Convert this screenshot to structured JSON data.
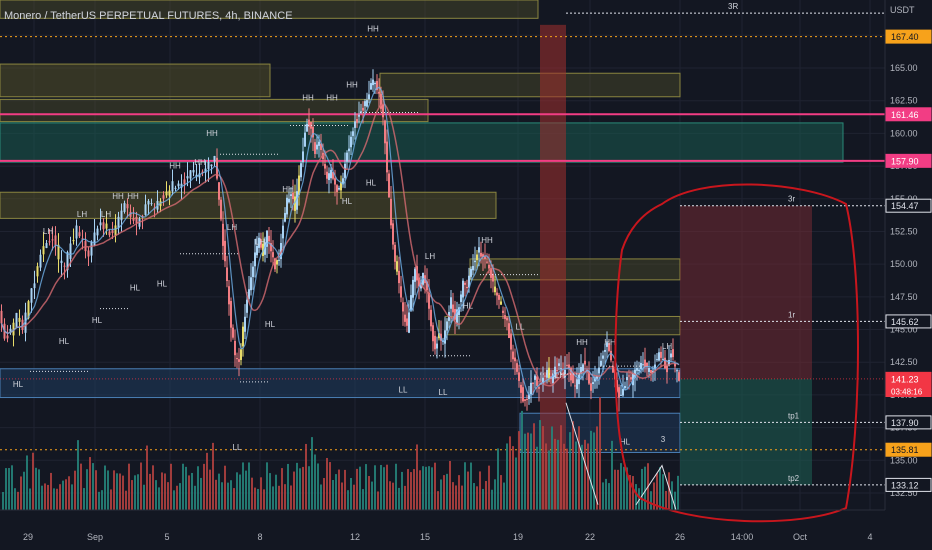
{
  "header": {
    "title": "Monero / TetherUS PERPETUAL FUTURES, 4h, BINANCE",
    "currency": "USDT"
  },
  "colors": {
    "background": "#131722",
    "up": "#a9d3f5",
    "down": "#f07c82",
    "volume_up": "#26837a",
    "volume_down": "#b0403f",
    "magenta": "#f23d84",
    "orange": "#f7a21b",
    "zone_yellow": "#5f5b2a",
    "zone_teal": "#1a5a4f",
    "zone_blue": "#1f3c5e",
    "red_circle": "#c8161d"
  },
  "chart_data": {
    "type": "candlestick",
    "symbol": "XMRUSDT.P",
    "timeframe": "4h",
    "ylim": [
      131.2,
      170.2
    ],
    "y_ticks": [
      132.5,
      135.0,
      137.5,
      140.0,
      142.5,
      145.0,
      147.5,
      150.0,
      152.5,
      155.0,
      157.5,
      160.0,
      162.5,
      165.0,
      167.5
    ],
    "x_ticks": [
      "29",
      "Sep",
      "5",
      "8",
      "12",
      "15",
      "19",
      "22",
      "26",
      "14:00",
      "Oct",
      "4"
    ],
    "price_labels": [
      {
        "text": "167.40",
        "value": 167.4,
        "style": "orange"
      },
      {
        "text": "161.46",
        "value": 161.46,
        "style": "magenta"
      },
      {
        "text": "157.90",
        "value": 157.9,
        "style": "magenta"
      },
      {
        "text": "154.47",
        "value": 154.47,
        "style": "white"
      },
      {
        "text": "145.62",
        "value": 145.62,
        "style": "white"
      },
      {
        "text": "141.23",
        "value": 141.23,
        "style": "red"
      },
      {
        "text": "03:48:16",
        "value": 140.3,
        "style": "red-small"
      },
      {
        "text": "137.90",
        "value": 137.9,
        "style": "white"
      },
      {
        "text": "135.81",
        "value": 135.81,
        "style": "orange"
      },
      {
        "text": "133.12",
        "value": 133.12,
        "style": "white"
      }
    ],
    "trade_targets": [
      {
        "label": "3R",
        "value": 169.2
      },
      {
        "label": "3r",
        "value": 154.47
      },
      {
        "label": "1r",
        "value": 145.62
      },
      {
        "label": "tp1",
        "value": 137.9
      },
      {
        "label": "tp2",
        "value": 133.12
      }
    ],
    "current_price": 141.23,
    "horizontal_lines": [
      {
        "value": 161.46,
        "style": "magenta"
      },
      {
        "value": 157.9,
        "style": "magenta"
      },
      {
        "value": 167.4,
        "style": "orange-dotted"
      },
      {
        "value": 135.81,
        "style": "orange-dotted"
      }
    ],
    "swing_labels": [
      "HH",
      "HL",
      "LH",
      "LL",
      "3"
    ],
    "price_path": [
      [
        0,
        146.2
      ],
      [
        6,
        144.3
      ],
      [
        12,
        144.8
      ],
      [
        18,
        146.0
      ],
      [
        24,
        145.0
      ],
      [
        30,
        147.1
      ],
      [
        36,
        148.8
      ],
      [
        42,
        150.6
      ],
      [
        48,
        151.9
      ],
      [
        54,
        152.1
      ],
      [
        60,
        150.3
      ],
      [
        66,
        149.8
      ],
      [
        72,
        151.5
      ],
      [
        78,
        152.7
      ],
      [
        84,
        151.8
      ],
      [
        90,
        150.6
      ],
      [
        96,
        152.4
      ],
      [
        102,
        153.2
      ],
      [
        108,
        152.5
      ],
      [
        114,
        152.1
      ],
      [
        120,
        153.6
      ],
      [
        126,
        154.4
      ],
      [
        132,
        153.8
      ],
      [
        138,
        152.9
      ],
      [
        144,
        153.9
      ],
      [
        150,
        154.8
      ],
      [
        156,
        154.2
      ],
      [
        162,
        155.0
      ],
      [
        168,
        155.5
      ],
      [
        174,
        156.1
      ],
      [
        180,
        156.0
      ],
      [
        186,
        156.4
      ],
      [
        192,
        157.0
      ],
      [
        198,
        156.8
      ],
      [
        204,
        157.2
      ],
      [
        210,
        157.6
      ],
      [
        216,
        158.0
      ],
      [
        220,
        155.0
      ],
      [
        224,
        151.5
      ],
      [
        228,
        148.5
      ],
      [
        232,
        145.4
      ],
      [
        236,
        143.0
      ],
      [
        240,
        142.5
      ],
      [
        244,
        145.0
      ],
      [
        248,
        147.4
      ],
      [
        252,
        149.2
      ],
      [
        256,
        150.6
      ],
      [
        260,
        152.0
      ],
      [
        264,
        150.8
      ],
      [
        268,
        152.4
      ],
      [
        272,
        151.2
      ],
      [
        276,
        149.8
      ],
      [
        280,
        150.4
      ],
      [
        284,
        153.0
      ],
      [
        288,
        154.8
      ],
      [
        292,
        155.6
      ],
      [
        296,
        154.2
      ],
      [
        300,
        156.6
      ],
      [
        304,
        158.8
      ],
      [
        308,
        161.0
      ],
      [
        312,
        160.2
      ],
      [
        316,
        158.6
      ],
      [
        320,
        159.4
      ],
      [
        324,
        157.8
      ],
      [
        328,
        156.4
      ],
      [
        332,
        157.1
      ],
      [
        336,
        156.0
      ],
      [
        340,
        155.6
      ],
      [
        344,
        156.8
      ],
      [
        348,
        158.5
      ],
      [
        352,
        159.6
      ],
      [
        356,
        160.8
      ],
      [
        360,
        161.4
      ],
      [
        364,
        161.9
      ],
      [
        368,
        162.6
      ],
      [
        372,
        163.6
      ],
      [
        376,
        164.1
      ],
      [
        380,
        162.8
      ],
      [
        384,
        161.2
      ],
      [
        388,
        157.0
      ],
      [
        392,
        153.0
      ],
      [
        396,
        150.2
      ],
      [
        400,
        148.4
      ],
      [
        404,
        146.2
      ],
      [
        408,
        145.0
      ],
      [
        412,
        147.4
      ],
      [
        416,
        149.8
      ],
      [
        420,
        148.3
      ],
      [
        424,
        149.1
      ],
      [
        428,
        148.0
      ],
      [
        432,
        145.2
      ],
      [
        436,
        143.6
      ],
      [
        440,
        144.6
      ],
      [
        444,
        144.0
      ],
      [
        448,
        145.8
      ],
      [
        452,
        147.2
      ],
      [
        456,
        145.8
      ],
      [
        460,
        147.0
      ],
      [
        464,
        148.5
      ],
      [
        468,
        148.1
      ],
      [
        472,
        149.6
      ],
      [
        476,
        150.4
      ],
      [
        480,
        151.0
      ],
      [
        484,
        150.5
      ],
      [
        488,
        150.0
      ],
      [
        492,
        149.0
      ],
      [
        496,
        148.0
      ],
      [
        500,
        147.0
      ],
      [
        504,
        146.4
      ],
      [
        508,
        145.6
      ],
      [
        512,
        143.6
      ],
      [
        516,
        142.4
      ],
      [
        520,
        141.0
      ],
      [
        524,
        139.8
      ],
      [
        528,
        139.8
      ],
      [
        532,
        140.8
      ],
      [
        536,
        141.2
      ],
      [
        540,
        140.6
      ],
      [
        544,
        141.4
      ],
      [
        548,
        141.8
      ],
      [
        552,
        141.1
      ],
      [
        556,
        141.9
      ],
      [
        560,
        142.2
      ],
      [
        564,
        141.6
      ],
      [
        568,
        142.4
      ],
      [
        572,
        141.4
      ],
      [
        576,
        140.6
      ],
      [
        580,
        141.6
      ],
      [
        584,
        142.6
      ],
      [
        588,
        141.6
      ],
      [
        592,
        140.6
      ],
      [
        596,
        141.2
      ],
      [
        600,
        142.0
      ],
      [
        604,
        143.0
      ],
      [
        608,
        143.8
      ],
      [
        612,
        142.4
      ],
      [
        616,
        141.0
      ],
      [
        620,
        139.8
      ],
      [
        624,
        140.4
      ],
      [
        628,
        141.4
      ],
      [
        632,
        141.0
      ],
      [
        636,
        141.8
      ],
      [
        640,
        142.1
      ],
      [
        644,
        142.6
      ],
      [
        648,
        142.0
      ],
      [
        652,
        141.6
      ],
      [
        656,
        142.6
      ],
      [
        660,
        143.2
      ],
      [
        664,
        142.6
      ],
      [
        668,
        142.0
      ],
      [
        672,
        143.4
      ],
      [
        676,
        141.9
      ],
      [
        680,
        141.3
      ]
    ]
  }
}
